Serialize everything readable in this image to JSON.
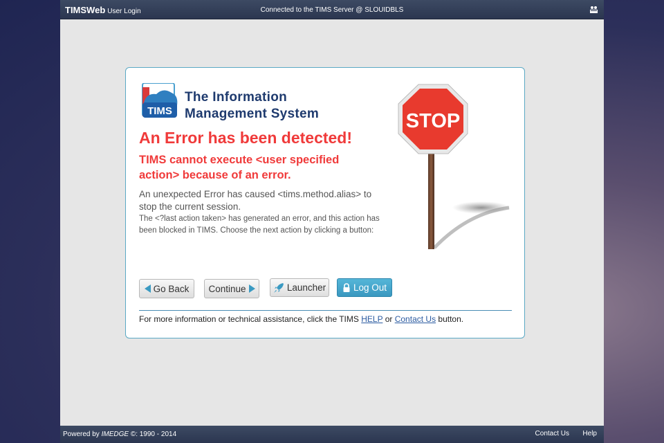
{
  "topbar": {
    "brand": "TIMSWeb",
    "brand_sub": "User Login",
    "server_status": "Connected to the TIMS Server @ SLOUIDBLS",
    "user_icon": "users-icon"
  },
  "logo": {
    "badge_text": "TIMS",
    "title_line1": "The Information",
    "title_line2": "Management System"
  },
  "error": {
    "heading": "An Error has been detected!",
    "subheading": "TIMS cannot execute <user specified action> because of an error.",
    "body1": "An unexpected Error has caused <tims.method.alias> to stop the current session.",
    "body2": "The <?last action taken> has generated an error, and this action has been blocked in TIMS. Choose the next action by clicking a button:"
  },
  "stop_sign": {
    "text": "STOP"
  },
  "buttons": {
    "go_back": "Go Back",
    "continue": "Continue",
    "launcher": "Launcher",
    "logout": "Log Out"
  },
  "info": {
    "prefix": "For more information or technical assistance, click the TIMS ",
    "help_link": "HELP",
    "or": " or ",
    "contact_link": "Contact Us",
    "suffix": " button."
  },
  "footer": {
    "powered_prefix": "Powered by ",
    "powered_brand": "IMEDGE",
    "powered_suffix": " ©: 1990 - 2014",
    "contact_us": "Contact Us",
    "help": "Help"
  },
  "colors": {
    "error_red": "#f03a3a",
    "brand_navy": "#1e3a6e",
    "accent_blue": "#3a9ac2",
    "bar_dark": "#2b3650"
  }
}
